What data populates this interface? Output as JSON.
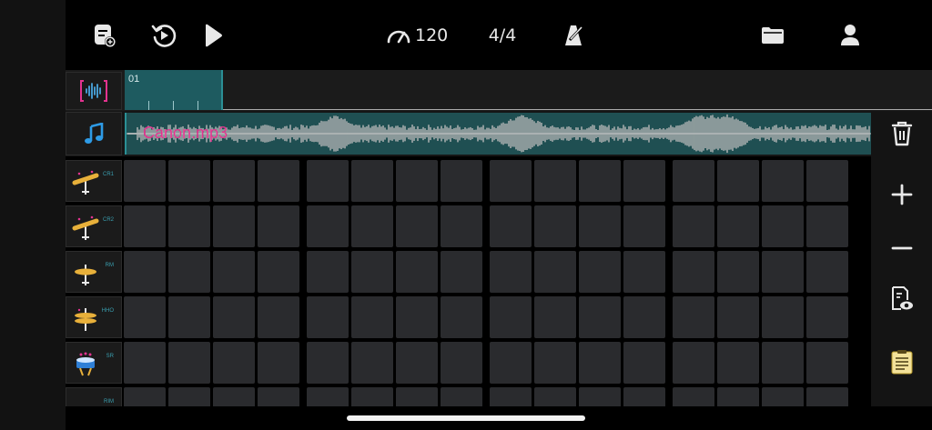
{
  "toolbar": {
    "tempo": "120",
    "time_signature": "4/4",
    "icons": [
      "new-pattern-icon",
      "history-icon",
      "play-icon",
      "tempo-gauge-icon",
      "metronome-icon",
      "folder-icon",
      "user-icon"
    ]
  },
  "ruler": {
    "loop_label": "01"
  },
  "audio_track": {
    "file_name": "Canon.mp3"
  },
  "instruments": [
    {
      "abbr": "CR1",
      "icon": "crash-cymbal-icon"
    },
    {
      "abbr": "CR2",
      "icon": "crash-cymbal-icon"
    },
    {
      "abbr": "RM",
      "icon": "ride-cymbal-icon"
    },
    {
      "abbr": "HHO",
      "icon": "hihat-open-icon"
    },
    {
      "abbr": "SR",
      "icon": "snare-icon"
    },
    {
      "abbr": "RIM",
      "icon": "rimshot-icon"
    }
  ],
  "right_panel": {
    "icons": [
      "trash-icon",
      "plus-icon",
      "minus-icon",
      "preview-sheet-icon",
      "notes-icon"
    ]
  },
  "colors": {
    "accent_teal": "#1e5b60",
    "accent_pink": "#e3338f",
    "pad": "#2a2b2e",
    "cymbal": "#e8b03a"
  }
}
